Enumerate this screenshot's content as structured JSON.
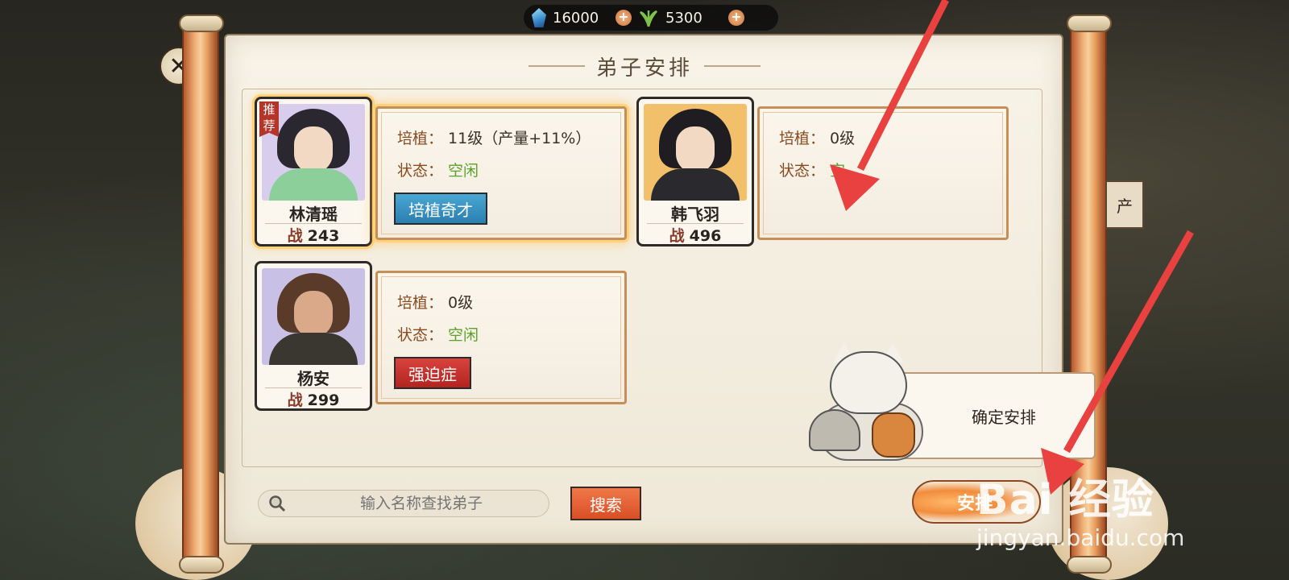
{
  "currency": [
    {
      "icon": "spirit-stone-icon",
      "value": "16000"
    },
    {
      "icon": "herb-icon",
      "value": "5300"
    }
  ],
  "panel_title": "弟子安排",
  "disciples": [
    {
      "name": "林清瑶",
      "power_label": "战",
      "power": "243",
      "badge": "推荐",
      "cultivate_label": "培植：",
      "cultivate_value": "11级（产量+11%）",
      "status_label": "状态：",
      "status_value": "空闲",
      "trait": "培植奇才",
      "trait_color": "#2a7fb0",
      "selected": true
    },
    {
      "name": "韩飞羽",
      "power_label": "战",
      "power": "496",
      "cultivate_label": "培植：",
      "cultivate_value": "0级",
      "status_label": "状态：",
      "status_value": "空",
      "selected": false
    },
    {
      "name": "杨安",
      "power_label": "战",
      "power": "299",
      "cultivate_label": "培植：",
      "cultivate_value": "0级",
      "status_label": "状态：",
      "status_value": "空闲",
      "trait": "强迫症",
      "trait_color": "#b3241f",
      "selected": false
    }
  ],
  "search": {
    "placeholder": "输入名称查找弟子",
    "button": "搜索"
  },
  "tooltip": "确定安排",
  "arrange_button": "安排",
  "side_stub": "产",
  "watermark": {
    "main": "Bai 经验",
    "sub": "jingyan.baidu.com"
  },
  "colors": {
    "idle_status": "#5aa22c",
    "arrow": "#e8413f",
    "selected_glow": "#ffd27a"
  }
}
